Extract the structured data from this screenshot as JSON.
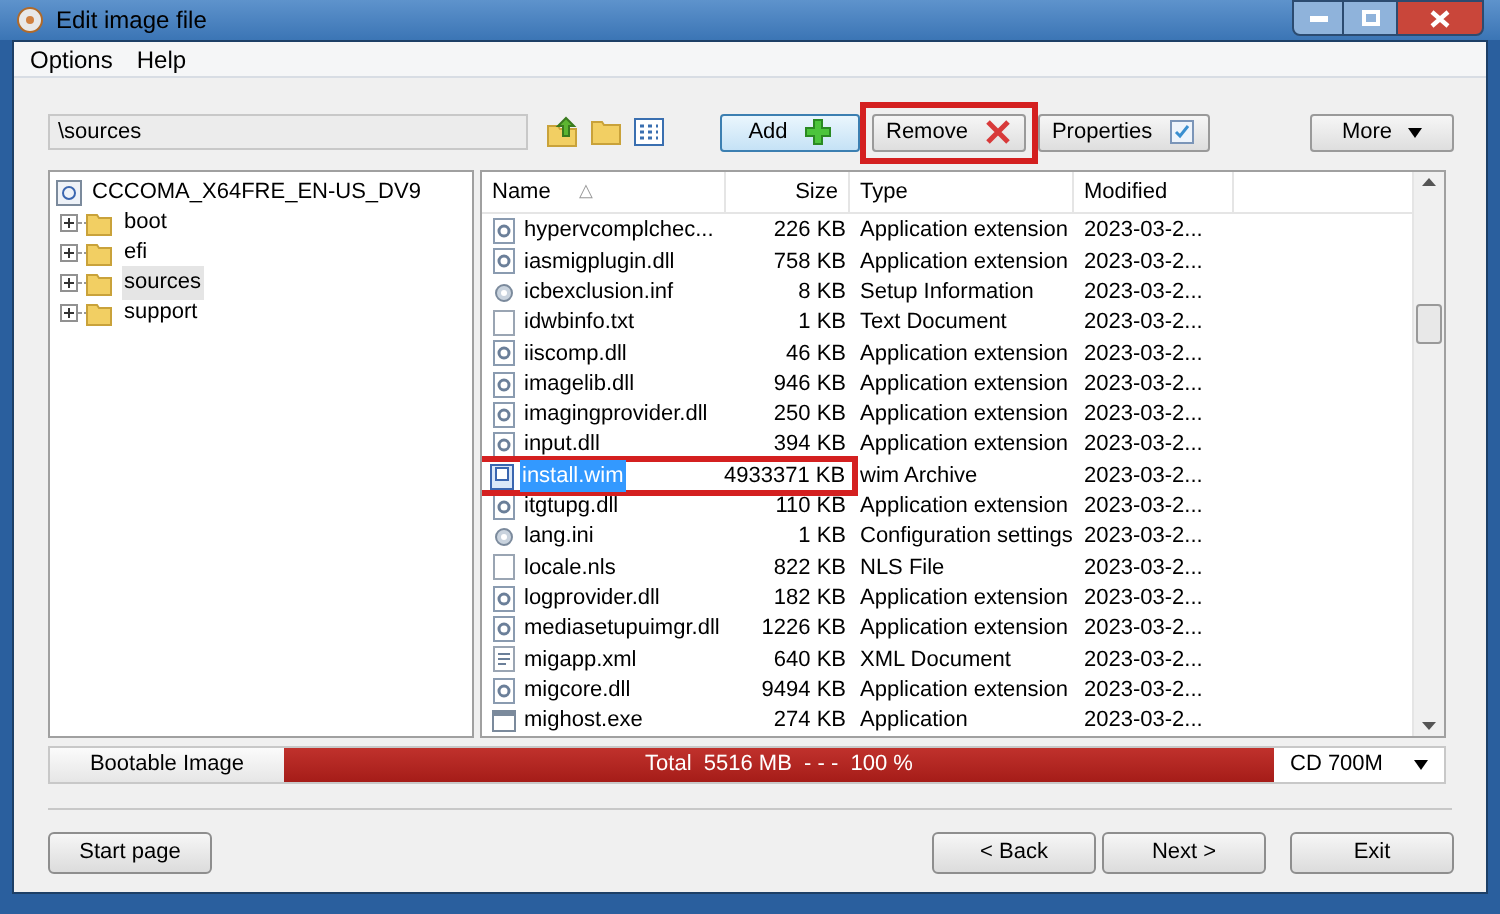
{
  "window": {
    "title": "Edit image file"
  },
  "menu": [
    "Options",
    "Help"
  ],
  "path_field": {
    "value": "\\sources"
  },
  "toolbar_buttons": [
    {
      "label": "Add",
      "kind": "add",
      "highlighted": false
    },
    {
      "label": "Remove",
      "kind": "remove",
      "highlighted": true
    },
    {
      "label": "Properties",
      "kind": "properties",
      "highlighted": false
    }
  ],
  "more_button": {
    "label": "More"
  },
  "tree": {
    "label": "CCCOMA_X64FRE_EN-US_DV9",
    "children": [
      {
        "label": "boot",
        "expanded": false,
        "selected": false
      },
      {
        "label": "efi",
        "expanded": false,
        "selected": false
      },
      {
        "label": "sources",
        "expanded": false,
        "selected": true
      },
      {
        "label": "support",
        "expanded": false,
        "selected": false
      }
    ]
  },
  "table": {
    "columns": [
      {
        "label": "Name",
        "sort_mark": "△"
      },
      {
        "label": "Size"
      },
      {
        "label": "Type"
      },
      {
        "label": "Modified"
      }
    ],
    "rows": [
      {
        "name": "hypervcomplchec...",
        "size": "226 KB",
        "type": "Application extension",
        "modified": "2023-03-2...",
        "kind": "dll",
        "selected": false,
        "highlighted": false
      },
      {
        "name": "iasmigplugin.dll",
        "size": "758 KB",
        "type": "Application extension",
        "modified": "2023-03-2...",
        "kind": "dll",
        "selected": false,
        "highlighted": false
      },
      {
        "name": "icbexclusion.inf",
        "size": "8 KB",
        "type": "Setup Information",
        "modified": "2023-03-2...",
        "kind": "config",
        "selected": false,
        "highlighted": false
      },
      {
        "name": "idwbinfo.txt",
        "size": "1 KB",
        "type": "Text Document",
        "modified": "2023-03-2...",
        "kind": "text",
        "selected": false,
        "highlighted": false
      },
      {
        "name": "iiscomp.dll",
        "size": "46 KB",
        "type": "Application extension",
        "modified": "2023-03-2...",
        "kind": "dll",
        "selected": false,
        "highlighted": false
      },
      {
        "name": "imagelib.dll",
        "size": "946 KB",
        "type": "Application extension",
        "modified": "2023-03-2...",
        "kind": "dll",
        "selected": false,
        "highlighted": false
      },
      {
        "name": "imagingprovider.dll",
        "size": "250 KB",
        "type": "Application extension",
        "modified": "2023-03-2...",
        "kind": "dll",
        "selected": false,
        "highlighted": false
      },
      {
        "name": "input.dll",
        "size": "394 KB",
        "type": "Application extension",
        "modified": "2023-03-2...",
        "kind": "dll",
        "selected": false,
        "highlighted": false
      },
      {
        "name": "install.wim",
        "size": "4933371 KB",
        "type": "wim Archive",
        "modified": "2023-03-2...",
        "kind": "archive",
        "selected": true,
        "highlighted": true
      },
      {
        "name": "itgtupg.dll",
        "size": "110 KB",
        "type": "Application extension",
        "modified": "2023-03-2...",
        "kind": "dll",
        "selected": false,
        "highlighted": false
      },
      {
        "name": "lang.ini",
        "size": "1 KB",
        "type": "Configuration settings",
        "modified": "2023-03-2...",
        "kind": "config",
        "selected": false,
        "highlighted": false
      },
      {
        "name": "locale.nls",
        "size": "822 KB",
        "type": "NLS File",
        "modified": "2023-03-2...",
        "kind": "text",
        "selected": false,
        "highlighted": false
      },
      {
        "name": "logprovider.dll",
        "size": "182 KB",
        "type": "Application extension",
        "modified": "2023-03-2...",
        "kind": "dll",
        "selected": false,
        "highlighted": false
      },
      {
        "name": "mediasetupuimgr.dll",
        "size": "1226 KB",
        "type": "Application extension",
        "modified": "2023-03-2...",
        "kind": "dll",
        "selected": false,
        "highlighted": false
      },
      {
        "name": "migapp.xml",
        "size": "640 KB",
        "type": "XML Document",
        "modified": "2023-03-2...",
        "kind": "xml",
        "selected": false,
        "highlighted": false
      },
      {
        "name": "migcore.dll",
        "size": "9494 KB",
        "type": "Application extension",
        "modified": "2023-03-2...",
        "kind": "dll",
        "selected": false,
        "highlighted": false
      },
      {
        "name": "mighost.exe",
        "size": "274 KB",
        "type": "Application",
        "modified": "2023-03-2...",
        "kind": "exe",
        "selected": false,
        "highlighted": false
      }
    ]
  },
  "status_bar": {
    "label": "Bootable Image",
    "total": "Total  5516 MB  - - -  100 %",
    "level": 1,
    "media": "CD 700M"
  },
  "footer_buttons": [
    {
      "label": "Start page",
      "kind": "left"
    },
    {
      "label": "< Back",
      "kind": "right"
    },
    {
      "label": "Next >",
      "kind": "right"
    },
    {
      "label": "Exit",
      "kind": "exit"
    }
  ]
}
